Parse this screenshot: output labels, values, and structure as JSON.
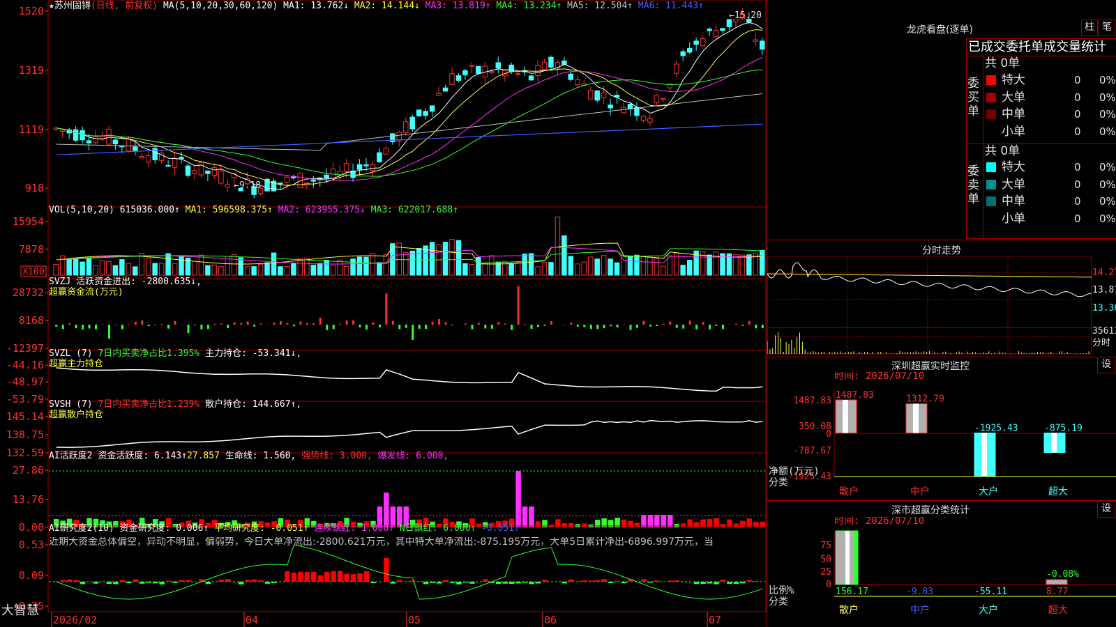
{
  "app": {
    "name": "大智慧"
  },
  "stock": {
    "name": "★苏州固锝",
    "mode": "(日线, 前复权)",
    "ma_label": "MA(5,10,20,30,60,120)",
    "ma": [
      {
        "label": "MA1:",
        "value": "13.762↓",
        "color": "#ffffff"
      },
      {
        "label": "MA2:",
        "value": "14.144↓",
        "color": "#ffff40"
      },
      {
        "label": "MA3:",
        "value": "13.819↑",
        "color": "#ff30ff"
      },
      {
        "label": "MA4:",
        "value": "13.234↑",
        "color": "#30ff30"
      },
      {
        "label": "MA5:",
        "value": "12.504↑",
        "color": "#c0c0c0"
      },
      {
        "label": "MA6:",
        "value": "11.443↑",
        "color": "#4060ff"
      }
    ],
    "y_ticks": [
      "1520",
      "1319",
      "1119",
      "918"
    ],
    "high_label": "15.20",
    "low_label": "9.18"
  },
  "vol": {
    "label": "VOL(5,10,20)",
    "value": "615036.000↑",
    "ma": [
      {
        "label": "MA1:",
        "value": "596598.375↑",
        "color": "#ffff40"
      },
      {
        "label": "MA2:",
        "value": "623955.375↓",
        "color": "#ff30ff"
      },
      {
        "label": "MA3:",
        "value": "622017.688↑",
        "color": "#30ff30"
      }
    ],
    "y_ticks": [
      "15954",
      "7878"
    ],
    "unit": "X100"
  },
  "svzj": {
    "label": "SVZJ  活跃资金进出:",
    "value": "-2800.635↓,",
    "sub": "超赢资金流(万元)",
    "y_ticks": [
      "28732",
      "8168",
      "-12397"
    ]
  },
  "svzl": {
    "label": "SVZL (7)",
    "extra": "7日内买卖净占比1.395%",
    "label2": "主力持仓:",
    "value": "-53.341↓,",
    "sub": "超赢主力持仓",
    "y_ticks": [
      "-44.16",
      "-48.97",
      "-53.79"
    ]
  },
  "svsh": {
    "label": "SVSH (7)",
    "extra": "7日内买卖净占比1.239%",
    "label2": "散户持仓:",
    "value": "144.667↑,",
    "sub": "超赢散户持仓",
    "y_ticks": [
      "145.14",
      "138.75",
      "132.59"
    ]
  },
  "ai1": {
    "label": "AI活跃度2",
    "t1": "资金活跃度:",
    "v1": "6.143↑",
    "v2": "27.857",
    "t3": "生命线:",
    "v3": "1.560,",
    "t4": "强势线:",
    "v4": "3.000,",
    "t5": "爆发线:",
    "v5": "6.000,",
    "y_ticks": [
      "27.86",
      "13.76",
      "0.00"
    ]
  },
  "ai2": {
    "label": "AI研究度2(10)",
    "t1": "资金研究度:",
    "v1": "0.006↑",
    "t2": "平均研究度:",
    "v2": "-0.051↑",
    "t3": "连续飘红:",
    "v3": "1.000↑",
    "t4": "N日飘红:",
    "v4": "6.000↑",
    "v5": "-0.051↑",
    "comment": "近期大资金总体偏空，异动不明显，偏弱势，今日大单净流出:-2800.621万元，其中特大单净流出:-875.195万元，大单5日累计净出-6896.997万元，当",
    "y_ticks": [
      "0.53",
      "0.09",
      "-0.35"
    ]
  },
  "x_axis": {
    "labels": [
      "2026/02",
      "04",
      "05",
      "06",
      "07"
    ]
  },
  "longhu": {
    "title": "龙虎看盘(逐单)",
    "btn1": "柱",
    "btn2": "笔",
    "subtitle": "已成交委托单成交量统计",
    "buy_label": "委买单",
    "sell_label": "委卖单",
    "buy_total": "共 0单",
    "sell_total": "共 0单",
    "rows": [
      {
        "name": "特大",
        "count": "0",
        "pct": "0%"
      },
      {
        "name": "大单",
        "count": "0",
        "pct": "0%"
      },
      {
        "name": "中单",
        "count": "0",
        "pct": "0%"
      },
      {
        "name": "小单",
        "count": "0",
        "pct": "0%"
      }
    ],
    "buy_colors": [
      "#ff0000",
      "#a00000",
      "#700000",
      ""
    ],
    "sell_colors": [
      "#00ffff",
      "#009090",
      "#007070",
      ""
    ]
  },
  "fenshi": {
    "title": "分时走势",
    "p1": "14.27",
    "p2": "13.81",
    "p3": "13.36",
    "vol": "35613",
    "vol_unit": "分时"
  },
  "monitor": {
    "title": "深圳超赢实时监控",
    "btn": "设",
    "time": "时间: 2026/07/10",
    "y_ticks": [
      "1487.83",
      "350.08",
      "0",
      "-787.67",
      "-1925.43"
    ],
    "ylabel": "净额(万元)",
    "xlabel": "分类",
    "categories": [
      "散户",
      "中户",
      "大户",
      "超大"
    ],
    "cat_colors": [
      "#ff3030",
      "#ff3030",
      "#40ffff",
      "#40ffff"
    ],
    "bar_labels": [
      "1487.83",
      "1312.79",
      "-1925.43",
      "-875.19"
    ]
  },
  "classify": {
    "title": "深市超赢分类统计",
    "btn": "设",
    "time": "时间: 2026/07/10",
    "y_ticks": [
      "75",
      "50",
      "25",
      "0"
    ],
    "ylabel": "比例%",
    "xlabel": "分类",
    "categories": [
      "散户",
      "中户",
      "大户",
      "超大"
    ],
    "values": [
      "156.17",
      "-9.83",
      "-55.11",
      "8.77"
    ],
    "value_colors": [
      "#30ff30",
      "#4060ff",
      "#40ffff",
      "#ff3030"
    ],
    "extra": "-0.08%"
  },
  "chart_data": [
    {
      "type": "candlestick",
      "title": "",
      "y_ticks": [
        15.2,
        13.19,
        11.19,
        9.18
      ],
      "x_ticks": [
        "2026/02",
        "04",
        "05",
        "06",
        "07"
      ],
      "high": 15.2,
      "low": 9.18,
      "last_ma": {
        "MA1": 13.762,
        "MA2": 14.144,
        "MA3": 13.819,
        "MA4": 13.234,
        "MA5": 12.504,
        "MA6": 11.443
      }
    },
    {
      "type": "bar",
      "title": "",
      "y_ticks": [
        15954,
        7878
      ],
      "last": 615036.0
    },
    {
      "type": "bar",
      "title": "",
      "y_ticks": [
        28732,
        8168,
        -12397
      ],
      "last": -2800.635
    },
    {
      "type": "line",
      "title": "",
      "y_ticks": [
        -44.16,
        -48.97,
        -53.79
      ],
      "last": -53.341
    },
    {
      "type": "line",
      "title": "",
      "y_ticks": [
        145.14,
        138.75,
        132.59
      ],
      "last": 144.667
    },
    {
      "type": "bar",
      "title": "",
      "y_ticks": [
        27.86,
        13.76,
        0.0
      ],
      "last": 6.143
    },
    {
      "type": "bar",
      "title": "",
      "y_ticks": [
        0.53,
        0.09,
        -0.35
      ],
      "last": 0.006
    },
    {
      "type": "bar",
      "title": "",
      "categories": [
        "散户",
        "中户",
        "大户",
        "超大"
      ],
      "values": [
        1487.83,
        1312.79,
        -1925.43,
        -875.19
      ],
      "ylim": [
        -1925.43,
        1487.83
      ]
    },
    {
      "type": "bar",
      "title": "",
      "categories": [
        "散户",
        "中户",
        "大户",
        "超大"
      ],
      "values": [
        156.17,
        -9.83,
        -55.11,
        8.77
      ]
    }
  ]
}
